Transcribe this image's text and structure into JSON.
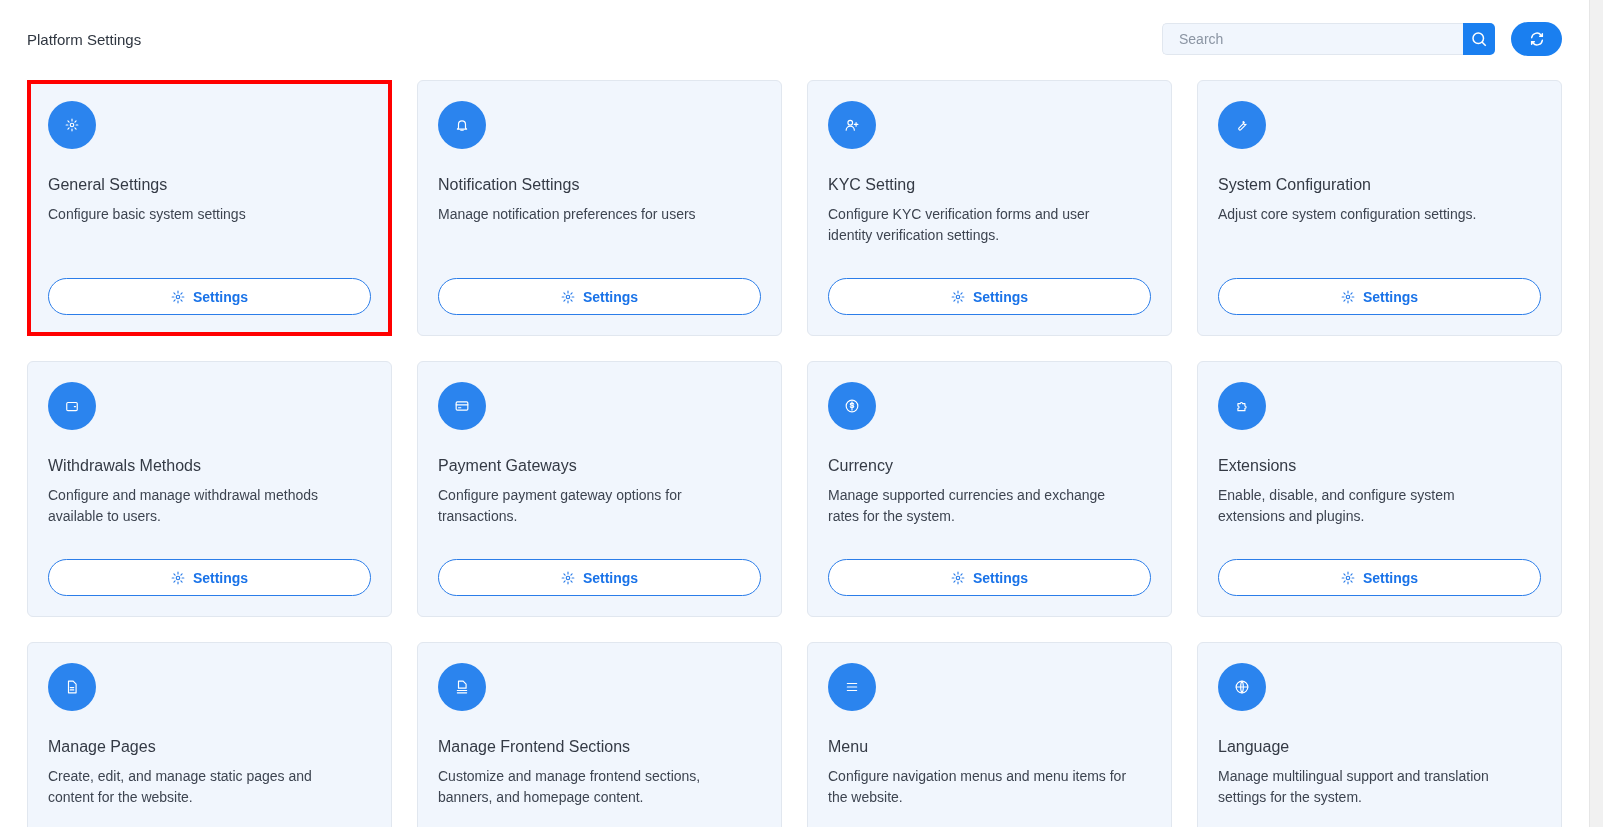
{
  "header": {
    "title": "Platform Settings",
    "search": {
      "placeholder": "Search"
    }
  },
  "cards": [
    {
      "title": "General Settings",
      "description": "Configure basic system settings",
      "button": "Settings",
      "highlighted": true
    },
    {
      "title": "Notification Settings",
      "description": "Manage notification preferences for users",
      "button": "Settings",
      "highlighted": false
    },
    {
      "title": "KYC Setting",
      "description": "Configure KYC verification forms and user identity verification settings.",
      "button": "Settings",
      "highlighted": false
    },
    {
      "title": "System Configuration",
      "description": "Adjust core system configuration settings.",
      "button": "Settings",
      "highlighted": false
    },
    {
      "title": "Withdrawals Methods",
      "description": "Configure and manage withdrawal methods available to users.",
      "button": "Settings",
      "highlighted": false
    },
    {
      "title": "Payment Gateways",
      "description": "Configure payment gateway options for transactions.",
      "button": "Settings",
      "highlighted": false
    },
    {
      "title": "Currency",
      "description": "Manage supported currencies and exchange rates for the system.",
      "button": "Settings",
      "highlighted": false
    },
    {
      "title": "Extensions",
      "description": "Enable, disable, and configure system extensions and plugins.",
      "button": "Settings",
      "highlighted": false
    },
    {
      "title": "Manage Pages",
      "description": "Create, edit, and manage static pages and content for the website.",
      "highlighted": false
    },
    {
      "title": "Manage Frontend Sections",
      "description": "Customize and manage frontend sections, banners, and homepage content.",
      "highlighted": false
    },
    {
      "title": "Menu",
      "description": "Configure navigation menus and menu items for the website.",
      "highlighted": false
    },
    {
      "title": "Language",
      "description": "Manage multilingual support and translation settings for the system.",
      "highlighted": false
    }
  ]
}
